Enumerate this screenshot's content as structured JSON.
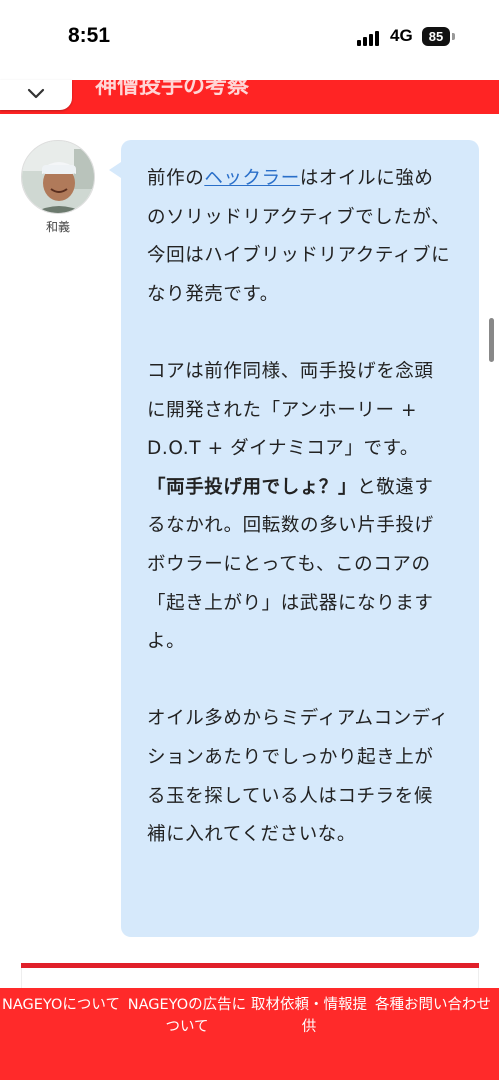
{
  "status_bar": {
    "time": "8:51",
    "network": "4G",
    "battery": "85"
  },
  "header": {
    "title_partial": "神僧投手の考察",
    "toggle_icon": "chevron-down-icon"
  },
  "speaker": {
    "name": "和義"
  },
  "article": {
    "p1_pre": "前作の",
    "p1_link": "ヘックラー",
    "p1_post": "はオイルに強めのソリッドリアクティブでしたが、今回はハイブリッドリアクティブになり発売です。",
    "p2": "コアは前作同様、両手投げを念頭に開発された「アンホーリー + D.O.T + ダイナミコア」です。",
    "p2_bold": "「両手投げ用でしょ？」",
    "p2_post": "と敬遠するなかれ。回転数の多い片手投げボウラーにとっても、このコアの「起き上がり」は武器になりますよ。",
    "p3": "オイル多めからミディアムコンディションあたりでしっかり起き上がる玉を探している人はコチラを候補に入れてくださいな。"
  },
  "footer": {
    "items": [
      {
        "label": "NAGEYOについて"
      },
      {
        "label": "NAGEYOの広告について"
      },
      {
        "label": "取材依頼・情報提供"
      },
      {
        "label": "各種お問い合わせ"
      }
    ]
  },
  "colors": {
    "brand_red": "#ff2a2a",
    "bubble_blue": "#d6e9fb",
    "link_blue": "#2a6fc9"
  }
}
